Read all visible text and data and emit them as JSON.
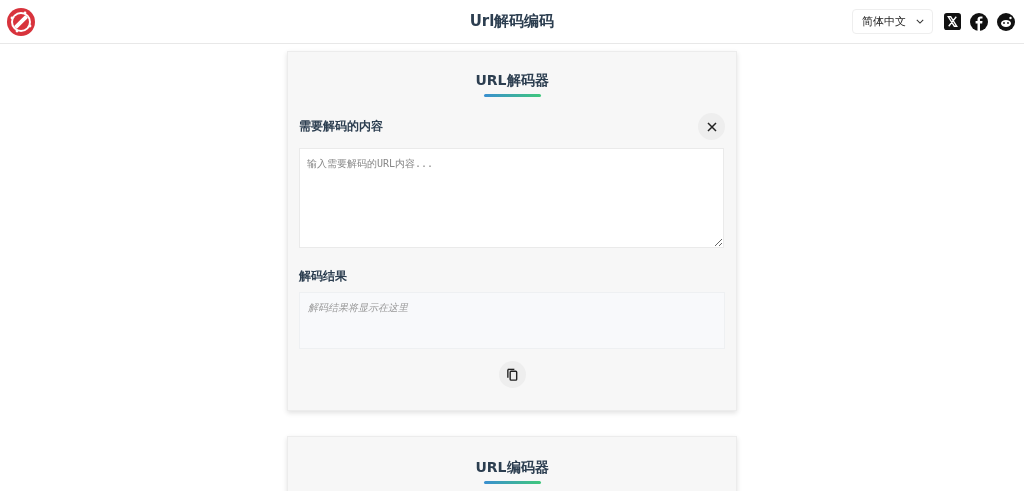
{
  "header": {
    "title": "Url解码编码",
    "language": "简体中文"
  },
  "decoder": {
    "title": "URL解码器",
    "input_label": "需要解码的内容",
    "input": {
      "placeholder": "输入需要解码的URL内容..."
    },
    "result_label": "解码结果",
    "result": {
      "placeholder": "解码结果将显示在这里"
    }
  },
  "encoder": {
    "title": "URL编码器"
  }
}
